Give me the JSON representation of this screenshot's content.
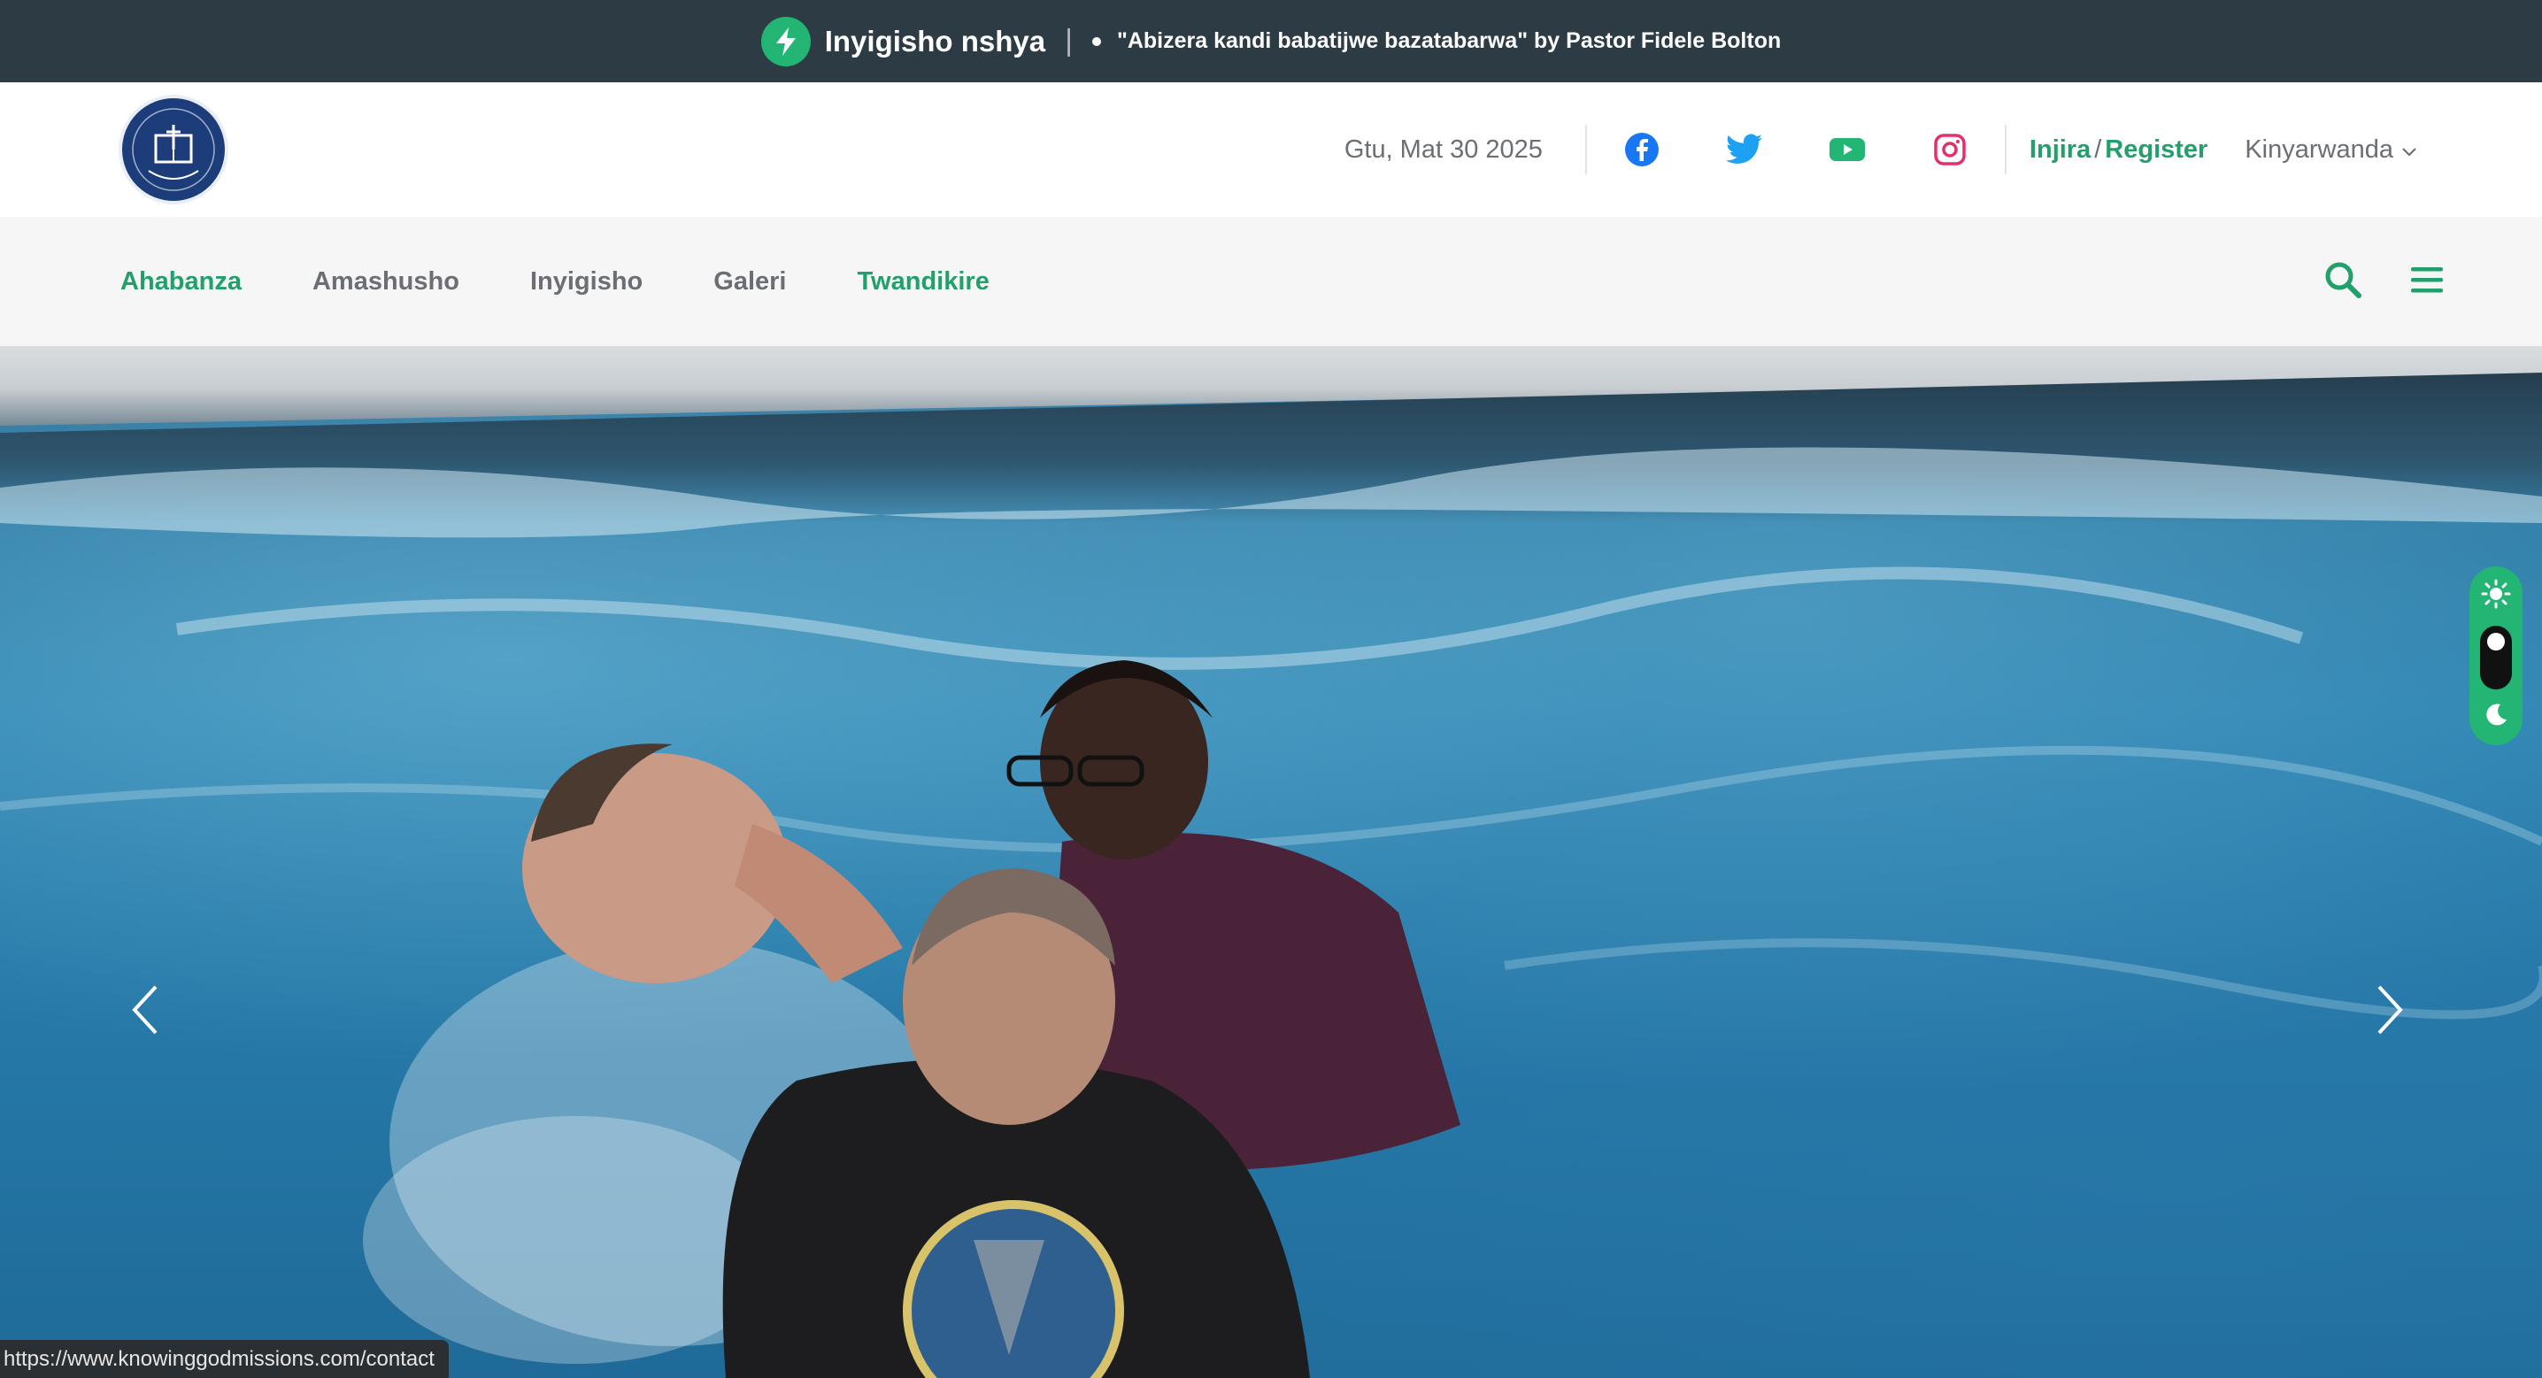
{
  "topbar": {
    "label": "Inyigisho nshya",
    "separator": "|",
    "ticker": "\"Abizera kandi babatijwe bazatabarwa\" by Pastor Fidele Bolton"
  },
  "header": {
    "date": "Gtu, Mat 30 2025",
    "social": [
      "facebook-icon",
      "twitter-icon",
      "youtube-icon",
      "instagram-icon"
    ],
    "login_label": "Injira",
    "auth_separator": "/",
    "register_label": "Register",
    "language": "Kinyarwanda"
  },
  "nav": {
    "items": [
      {
        "label": "Ahabanza",
        "active": true
      },
      {
        "label": "Amashusho",
        "active": false
      },
      {
        "label": "Inyigisho",
        "active": false
      },
      {
        "label": "Galeri",
        "active": false
      },
      {
        "label": "Twandikire",
        "active": true
      }
    ]
  },
  "status_url": "https://www.knowinggodmissions.com/contact",
  "colors": {
    "accent": "#22a06b",
    "topbar_bg": "#2d3b45",
    "facebook": "#1877f2",
    "twitter": "#1da1f2",
    "youtube": "#22b573",
    "instagram": "#e1306c"
  }
}
